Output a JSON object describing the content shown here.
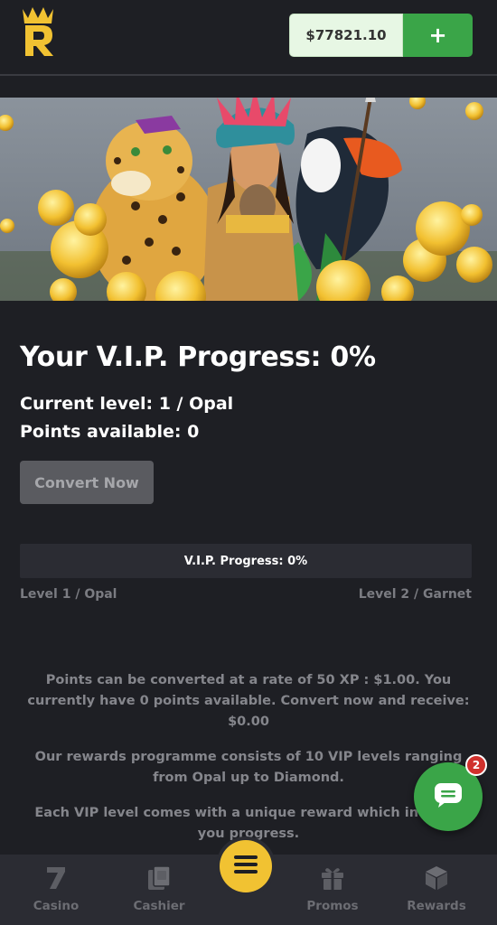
{
  "header": {
    "logo_icon": "crown-r-logo-icon",
    "balance": "$77821.10",
    "deposit_label": "+"
  },
  "banner": {
    "description_icon": "jungle-vip-banner-image"
  },
  "vip": {
    "title": "Your V.I.P. Progress: 0%",
    "current_level": "Current level: 1 / Opal",
    "points_available": "Points available: 0",
    "convert_label": "Convert Now",
    "progress_label": "V.I.P. Progress: 0%",
    "progress_percent": 0,
    "level_from": "Level 1 / Opal",
    "level_to": "Level 2 / Garnet"
  },
  "info": {
    "paragraph_1": "Points can be converted at a rate of 50 XP : $1.00. You currently have 0 points available. Convert now and receive: $0.00",
    "paragraph_2": "Our rewards programme consists of 10 VIP levels ranging from Opal up to Diamond.",
    "paragraph_3": "Each VIP level comes with a unique reward which inc... as you progress."
  },
  "chat": {
    "icon": "chat-bubble-icon",
    "badge_count": "2"
  },
  "nav": {
    "items": [
      {
        "label": "Casino",
        "icon": "seven-icon"
      },
      {
        "label": "Cashier",
        "icon": "cards-icon"
      },
      {
        "label": "Promos",
        "icon": "gift-icon"
      },
      {
        "label": "Rewards",
        "icon": "cube-icon"
      }
    ],
    "menu_icon": "hamburger-icon"
  },
  "colors": {
    "background": "#1e1f24",
    "accent_green": "#3aa548",
    "accent_yellow": "#f1c232",
    "badge_red": "#d0312d"
  }
}
